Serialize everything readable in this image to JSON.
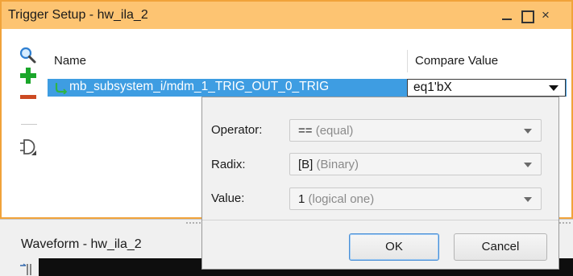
{
  "trigger_setup": {
    "title": "Trigger Setup - hw_ila_2",
    "window_buttons": {
      "minimize": "minimize",
      "maximize": "maximize",
      "close": "×"
    },
    "toolbar": [
      "search-icon",
      "add-icon",
      "remove-icon",
      "gate-icon"
    ],
    "table": {
      "columns": [
        "Name",
        "Compare Value"
      ],
      "rows": [
        {
          "name": "mb_subsystem_i/mdm_1_TRIG_OUT_0_TRIG",
          "compare_value": "eq1'bX",
          "selected": true
        }
      ]
    }
  },
  "compare_editor": {
    "operator": {
      "label": "Operator:",
      "value": "==",
      "note": "(equal)"
    },
    "radix": {
      "label": "Radix:",
      "value": "[B]",
      "note": "(Binary)"
    },
    "value": {
      "label": "Value:",
      "value": "1",
      "note": "(logical one)"
    },
    "ok_label": "OK",
    "cancel_label": "Cancel"
  },
  "waveform": {
    "title": "Waveform - hw_ila_2"
  },
  "colors": {
    "titlebar": "#fdc472",
    "panel_border": "#f1a33a",
    "selection": "#3e9de2",
    "add_icon": "#1aa62a",
    "remove_icon": "#cc4a22"
  }
}
